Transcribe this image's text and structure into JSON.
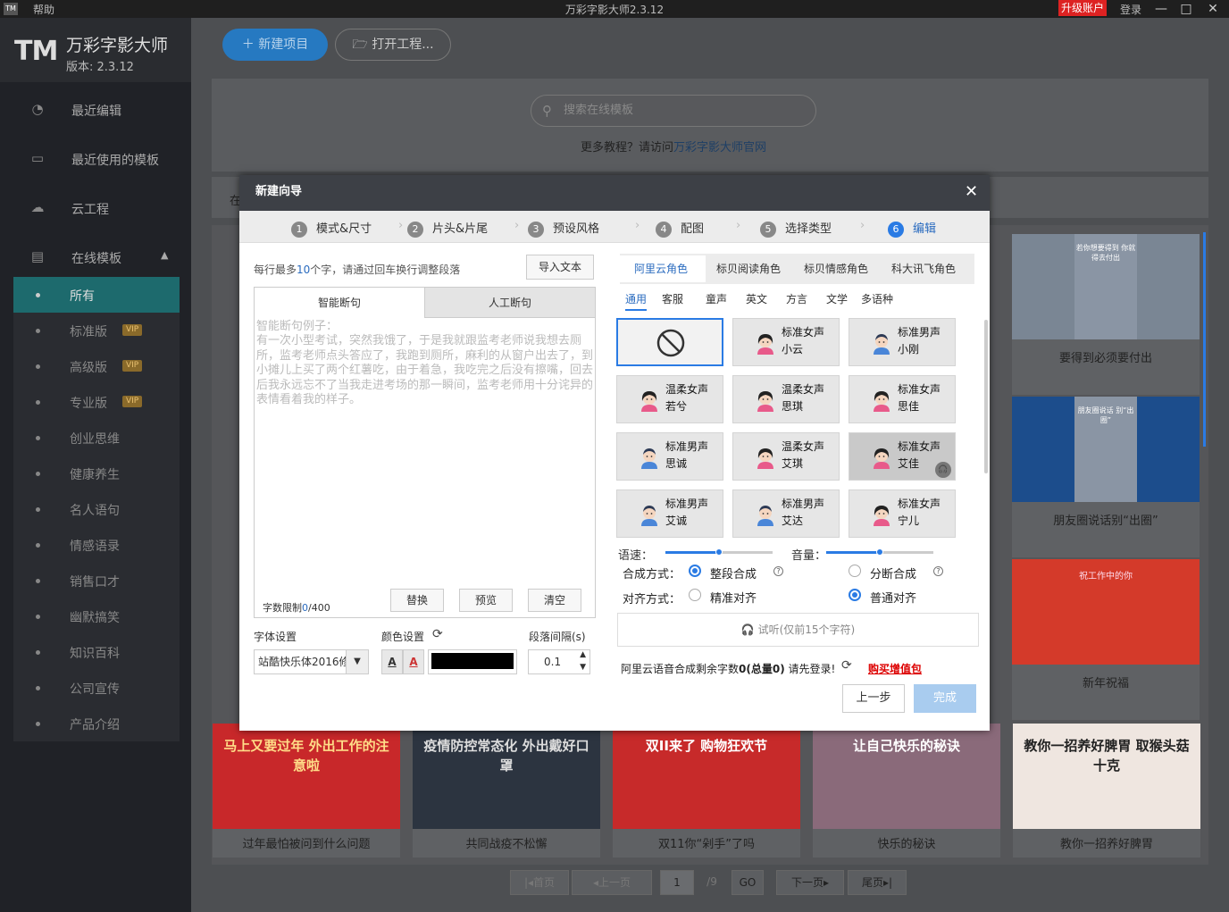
{
  "titlebar": {
    "logo": "TM",
    "help": "帮助",
    "title": "万彩字影大师2.3.12",
    "upgrade": "升级账户",
    "login": "登录",
    "min": "—",
    "max": "□",
    "close": "✕"
  },
  "brand": {
    "logo": "TM",
    "name": "万彩字影大师",
    "version": "版本: 2.3.12"
  },
  "nav": {
    "recent_edit": "最近编辑",
    "recent_templates": "最近使用的模板",
    "cloud": "云工程",
    "online": "在线模板"
  },
  "categories": [
    {
      "label": "所有",
      "vip": ""
    },
    {
      "label": "标准版",
      "vip": "VIP"
    },
    {
      "label": "高级版",
      "vip": "VIP"
    },
    {
      "label": "专业版",
      "vip": "VIP"
    },
    {
      "label": "创业思维",
      "vip": ""
    },
    {
      "label": "健康养生",
      "vip": ""
    },
    {
      "label": "名人语句",
      "vip": ""
    },
    {
      "label": "情感语录",
      "vip": ""
    },
    {
      "label": "销售口才",
      "vip": ""
    },
    {
      "label": "幽默搞笑",
      "vip": ""
    },
    {
      "label": "知识百科",
      "vip": ""
    },
    {
      "label": "公司宣传",
      "vip": ""
    },
    {
      "label": "产品介绍",
      "vip": ""
    }
  ],
  "toolbar": {
    "new": "新建项目",
    "open": "打开工程..."
  },
  "search": {
    "placeholder": "搜索在线模板"
  },
  "tutorial": {
    "prefix": "更多教程？请访问",
    "link": "万彩字影大师官网"
  },
  "partial_label": "在",
  "cards_right": [
    {
      "caption": "要得到必须要付出",
      "thumb": "若你想要得到 你就得去付出"
    },
    {
      "caption": "朋友圈说话别“出圈”",
      "thumb": "朋友圈说话 别“出圈”"
    },
    {
      "caption": "新年祝福",
      "thumb": "祝工作中的你"
    }
  ],
  "cards_bottom": [
    {
      "caption": "过年最怕被问到什么问题",
      "thumb": "马上又要过年 外出工作的注意啦"
    },
    {
      "caption": "共同战疫不松懈",
      "thumb": "疫情防控常态化 外出戴好口罩"
    },
    {
      "caption": "双11你“剁手”了吗",
      "thumb": "双II来了 购物狂欢节"
    },
    {
      "caption": "快乐的秘诀",
      "thumb": "让自己快乐的秘诀"
    },
    {
      "caption": "教你一招养好脾胃",
      "thumb": "教你一招养好脾胃 取猴头菇十克"
    }
  ],
  "pager": {
    "first": "|◂首页",
    "prev": "◂上一页",
    "page": "1",
    "total": "/9",
    "go": "GO",
    "next": "下一页▸",
    "last": "尾页▸|"
  },
  "dialog": {
    "title": "新建向导",
    "close": "✕",
    "steps": [
      {
        "n": "1",
        "label": "模式&尺寸"
      },
      {
        "n": "2",
        "label": "片头&片尾"
      },
      {
        "n": "3",
        "label": "预设风格"
      },
      {
        "n": "4",
        "label": "配图"
      },
      {
        "n": "5",
        "label": "选择类型"
      },
      {
        "n": "6",
        "label": "编辑"
      }
    ],
    "hint_pre": "每行最多",
    "hint_num": "10",
    "hint_post": "个字，请通过回车换行调整段落",
    "import": "导入文本",
    "tab_smart": "智能断句",
    "tab_manual": "人工断句",
    "example": "智能断句例子：\n有一次小型考试，突然我饿了，于是我就跟监考老师说我想去厕所，监考老师点头答应了，我跑到厕所，麻利的从窗户出去了，到小摊儿上买了两个红薯吃，由于着急，我吃完之后没有擦嘴，回去后我永远忘不了当我走进考场的那一瞬间，监考老师用十分诧异的表情看着我的样子。",
    "limit_label": "字数限制",
    "limit_used": "0",
    "limit_max": "/400",
    "replace": "替换",
    "preview": "预览",
    "clear": "清空",
    "font_label": "字体设置",
    "font_value": "站酷快乐体2016修",
    "color_label": "颜色设置",
    "color_value": "#000000",
    "spacing_label": "段落间隔(s)",
    "spacing_value": "0.1",
    "provider_tabs": [
      "阿里云角色",
      "标贝阅读角色",
      "标贝情感角色",
      "科大讯飞角色"
    ],
    "subtabs": [
      "通用",
      "客服",
      "童声",
      "英文",
      "方言",
      "文学",
      "多语种"
    ],
    "voices": [
      {
        "l1": "",
        "l2": "",
        "g": "none"
      },
      {
        "l1": "标准女声",
        "l2": "小云",
        "g": "f"
      },
      {
        "l1": "标准男声",
        "l2": "小刚",
        "g": "m"
      },
      {
        "l1": "温柔女声",
        "l2": "若兮",
        "g": "f"
      },
      {
        "l1": "温柔女声",
        "l2": "思琪",
        "g": "f"
      },
      {
        "l1": "标准女声",
        "l2": "思佳",
        "g": "f"
      },
      {
        "l1": "标准男声",
        "l2": "思诚",
        "g": "m"
      },
      {
        "l1": "温柔女声",
        "l2": "艾琪",
        "g": "f"
      },
      {
        "l1": "标准女声",
        "l2": "艾佳",
        "g": "f"
      },
      {
        "l1": "标准男声",
        "l2": "艾诚",
        "g": "m"
      },
      {
        "l1": "标准男声",
        "l2": "艾达",
        "g": "m"
      },
      {
        "l1": "标准女声",
        "l2": "宁儿",
        "g": "f"
      }
    ],
    "speed_label": "语速：",
    "speed_value": 0.5,
    "volume_label": "音量：",
    "volume_value": 0.5,
    "synth_label": "合成方式：",
    "synth_whole": "整段合成",
    "synth_split": "分断合成",
    "align_label": "对齐方式：",
    "align_precise": "精准对齐",
    "align_normal": "普通对齐",
    "trial": "试听(仅前15个字符)",
    "quota_pre": "阿里云语音合成剩余字数",
    "quota_num": "0(总量0)",
    "quota_post": " 请先登录!",
    "buy": "购买增值包",
    "prev": "上一步",
    "finish": "完成"
  }
}
